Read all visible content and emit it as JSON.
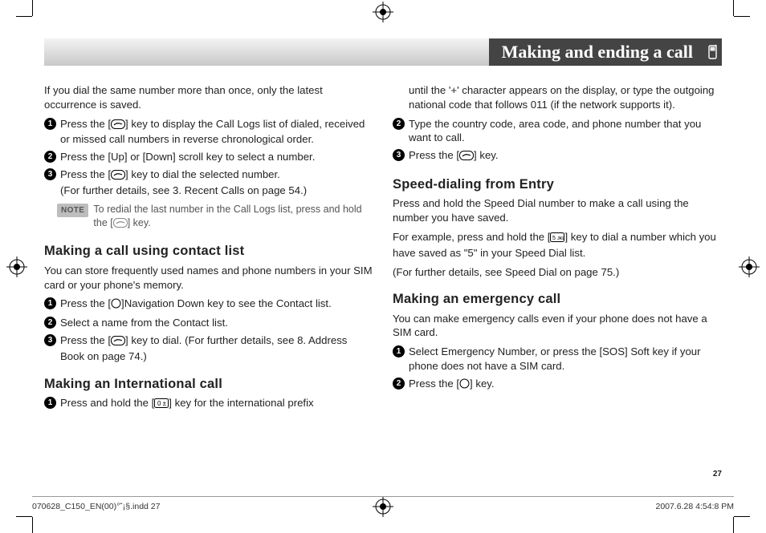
{
  "header": {
    "title": "Making and ending a call"
  },
  "col1": {
    "intro": "If you dial the same number more than once, only the latest occurrence is saved.",
    "steps_a": [
      "Press the [​] key to display the Call Logs list of dialed, received or missed call numbers in reverse chronological order.",
      "Press the [Up] or [Down] scroll key to select a number.",
      "Press the [​] key to dial the selected number. (For further details, see 3. Recent Calls on page 54.)"
    ],
    "note_label": "NOTE",
    "note_text": "To redial the last number in the Call Logs list, press and hold the [​] key.",
    "sec_b_title": "Making a call using contact list",
    "sec_b_intro": "You can store frequently used names and phone numbers in your SIM card or your phone's memory.",
    "steps_b": [
      "Press the [​]Navigation Down key to see the Contact list.",
      "Select a name from the Contact list.",
      "Press the [​] key to dial. (For further details, see 8. Address Book on page 74.)"
    ],
    "sec_c_title": "Making an International call",
    "steps_c": [
      "Press and hold the [​] key for the international prefix"
    ]
  },
  "col2": {
    "cont": "until the '+' character appears on the display, or type the outgoing national code that follows 011 (if the network supports it).",
    "steps_d": [
      "Type the country code, area code, and phone number that you want to call.",
      "Press the [​] key."
    ],
    "sec_e_title": "Speed-dialing from Entry",
    "sec_e_p1": "Press and hold the Speed Dial number to make a call using the number you have saved.",
    "sec_e_p2": "For example, press and hold the [​] key to dial a number which you have saved as \"5\" in your Speed Dial list.",
    "sec_e_p3": "(For further details, see Speed Dial on page 75.)",
    "sec_f_title": "Making an emergency call",
    "sec_f_intro": "You can make emergency calls even if your phone does not have a SIM card.",
    "steps_f": [
      "Select Emergency Number, or press the [SOS] Soft key if your phone does not have a SIM card.",
      "Press the [​] key."
    ]
  },
  "page_number": "27",
  "footer": {
    "left": "070628_C150_EN(00)°˘¡§.indd   27",
    "right": "2007.6.28   4:54:8 PM"
  },
  "icons": {
    "key_phone": "phone-key-icon",
    "key_zero": "zero-key-icon",
    "key_five": "five-key-icon",
    "key_nav": "nav-key-icon"
  }
}
